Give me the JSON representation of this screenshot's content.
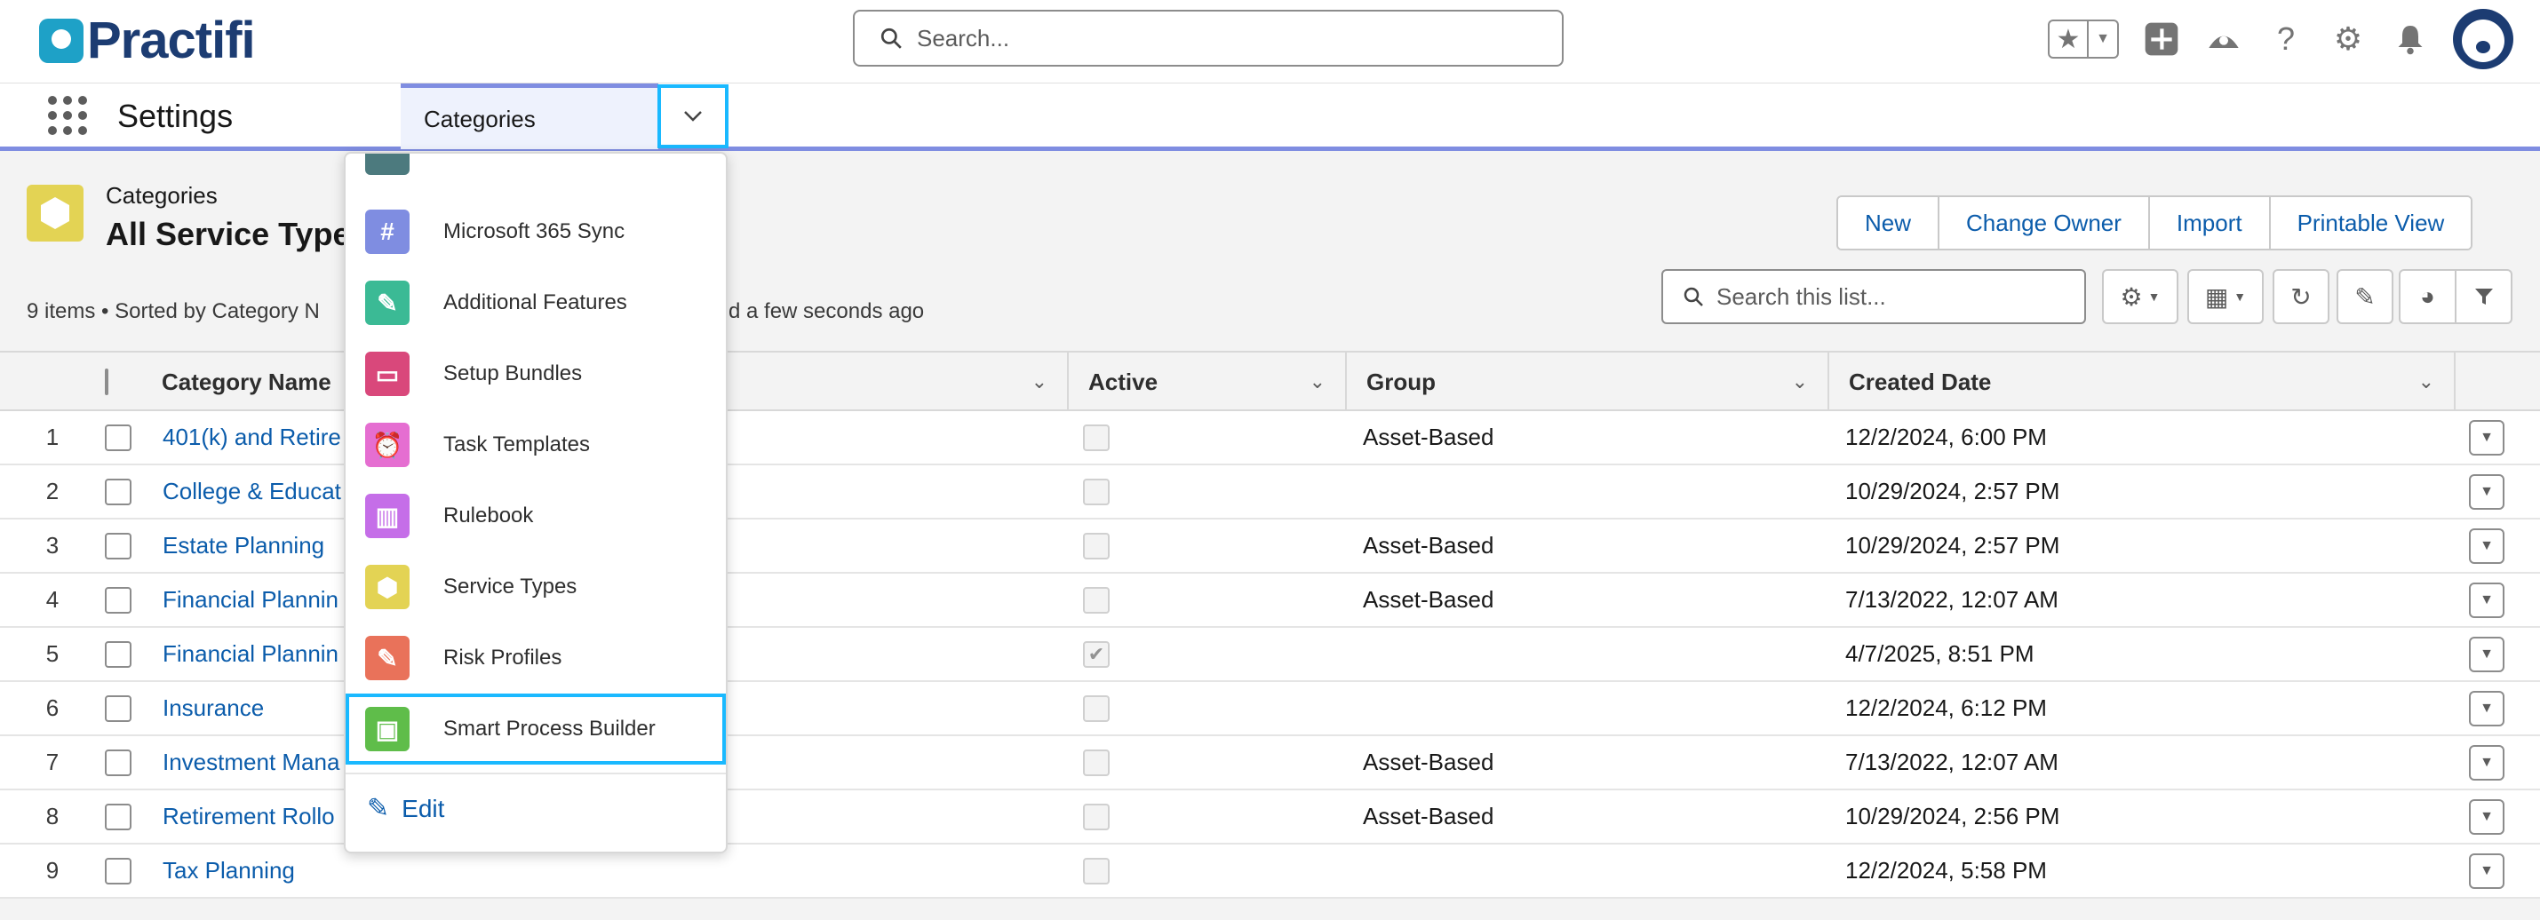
{
  "brand": {
    "name": "Practifi",
    "accent": "#1ea1c7",
    "navy": "#1c3c72"
  },
  "global_search": {
    "placeholder": "Search..."
  },
  "header_icons": [
    "favorites-star-icon",
    "plus-icon",
    "trailhead-icon",
    "help-icon",
    "setup-gear-icon",
    "notification-bell-icon",
    "avatar"
  ],
  "nav": {
    "app_name": "Settings",
    "current_tab": "Categories"
  },
  "list_view": {
    "object_label": "Categories",
    "title": "All Service Types",
    "meta": "9 items • Sorted by Category N",
    "meta_tail": "d a few seconds ago",
    "buttons": [
      "New",
      "Change Owner",
      "Import",
      "Printable View"
    ],
    "search_placeholder": "Search this list..."
  },
  "table": {
    "columns": [
      "Category Name",
      "Active",
      "Group",
      "Created Date"
    ],
    "rows": [
      {
        "num": "1",
        "name": "401(k) and Retire",
        "active": false,
        "group": "Asset-Based",
        "created": "12/2/2024, 6:00 PM"
      },
      {
        "num": "2",
        "name": "College & Educat",
        "active": false,
        "group": "",
        "created": "10/29/2024, 2:57 PM"
      },
      {
        "num": "3",
        "name": "Estate Planning",
        "active": false,
        "group": "Asset-Based",
        "created": "10/29/2024, 2:57 PM"
      },
      {
        "num": "4",
        "name": "Financial Plannin",
        "active": false,
        "group": "Asset-Based",
        "created": "7/13/2022, 12:07 AM"
      },
      {
        "num": "5",
        "name": "Financial Plannin",
        "active": true,
        "group": "",
        "created": "4/7/2025, 8:51 PM"
      },
      {
        "num": "6",
        "name": "Insurance",
        "active": false,
        "group": "",
        "created": "12/2/2024, 6:12 PM"
      },
      {
        "num": "7",
        "name": "Investment Mana",
        "active": false,
        "group": "Asset-Based",
        "created": "7/13/2022, 12:07 AM"
      },
      {
        "num": "8",
        "name": "Retirement Rollo",
        "active": false,
        "group": "Asset-Based",
        "created": "10/29/2024, 2:56 PM"
      },
      {
        "num": "9",
        "name": "Tax Planning",
        "active": false,
        "group": "",
        "created": "12/2/2024, 5:58 PM"
      }
    ]
  },
  "dropdown": {
    "items": [
      {
        "label": "Microsoft 365 Sync",
        "icon": "hash-icon",
        "color": "#7f8de1",
        "glyph": "#"
      },
      {
        "label": "Additional Features",
        "icon": "wrench-icon",
        "color": "#3bba95",
        "glyph": "✎"
      },
      {
        "label": "Setup Bundles",
        "icon": "archive-icon",
        "color": "#d9487b",
        "glyph": "▭"
      },
      {
        "label": "Task Templates",
        "icon": "alarm-clock-icon",
        "color": "#e56ed1",
        "glyph": "⏰"
      },
      {
        "label": "Rulebook",
        "icon": "book-icon",
        "color": "#c56ee8",
        "glyph": "▥"
      },
      {
        "label": "Service Types",
        "icon": "hexagon-icon",
        "color": "#e3d354",
        "glyph": "⬢"
      },
      {
        "label": "Risk Profiles",
        "icon": "pencil-icon",
        "color": "#e9725a",
        "glyph": "✎"
      },
      {
        "label": "Smart Process Builder",
        "icon": "chip-icon",
        "color": "#5fbd4a",
        "glyph": "▣"
      }
    ],
    "active_index": 7,
    "edit_label": "Edit"
  }
}
